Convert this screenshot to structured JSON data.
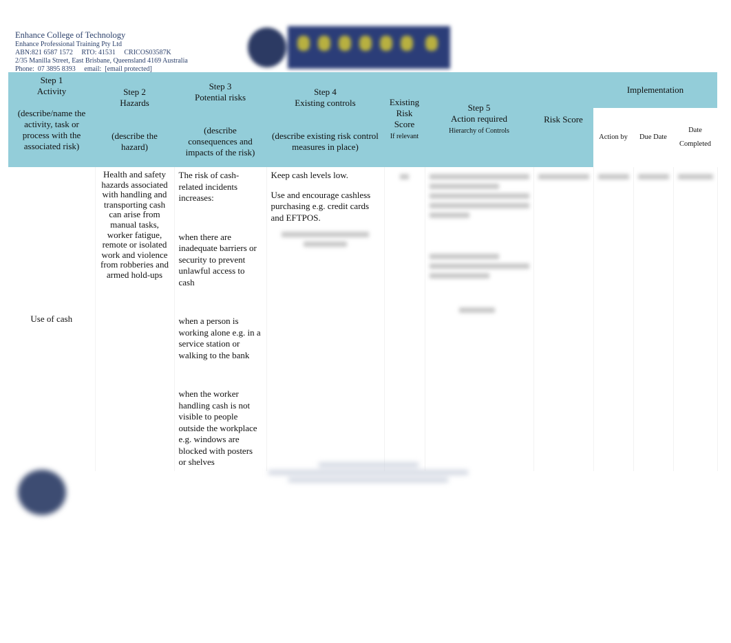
{
  "header": {
    "org_name": "Enhance College of Technology",
    "company": "Enhance Professional Training Pty Ltd",
    "ids": "ABN:821 6587 1572     RTO: 41531     CRICOS03587K",
    "address": "2/35 Manilla Street, East Brisbane, Queensland 4169 Australia",
    "contact": "Phone:  07 3895 8393     email:  [email protected]"
  },
  "table": {
    "columns": {
      "step1": {
        "title": "Step 1",
        "name": "Activity",
        "desc": "(describe/name the activity, task or process with the associated risk)"
      },
      "step2": {
        "title": "Step 2",
        "name": "Hazards",
        "desc": "(describe the hazard)"
      },
      "step3": {
        "title": "Step 3",
        "name": "Potential risks",
        "desc": "(describe consequences and impacts of the risk)"
      },
      "step4": {
        "title": "Step 4",
        "name": "Existing controls",
        "desc": "(describe existing risk control measures in place)"
      },
      "existing": {
        "name": "Existing Risk Score",
        "note": "If relevant"
      },
      "step5": {
        "title": "Step 5",
        "name": "Action required",
        "note": "Hierarchy of Controls"
      },
      "risk_score": "Risk Score",
      "implementation": "Implementation",
      "action_by": "Action by",
      "due_date": "Due Date",
      "date_completed": "Date Completed"
    },
    "row": {
      "activity": "Use of cash",
      "hazard": "Health and safety hazards associated with handling and transporting cash can arise from manual tasks, worker fatigue, remote or isolated work and violence from robberies and armed hold-ups",
      "risks": [
        "The risk of cash-related incidents increases:",
        "when there are inadequate barriers or security to prevent unlawful access to cash",
        "when a person is working alone e.g. in a service station or walking to the bank",
        "when the worker handling cash is not visible to people outside the workplace e.g. windows are blocked with posters or shelves"
      ],
      "controls": [
        "Keep cash levels low.",
        "Use and encourage cashless purchasing e.g. credit cards and EFTPOS."
      ]
    }
  }
}
